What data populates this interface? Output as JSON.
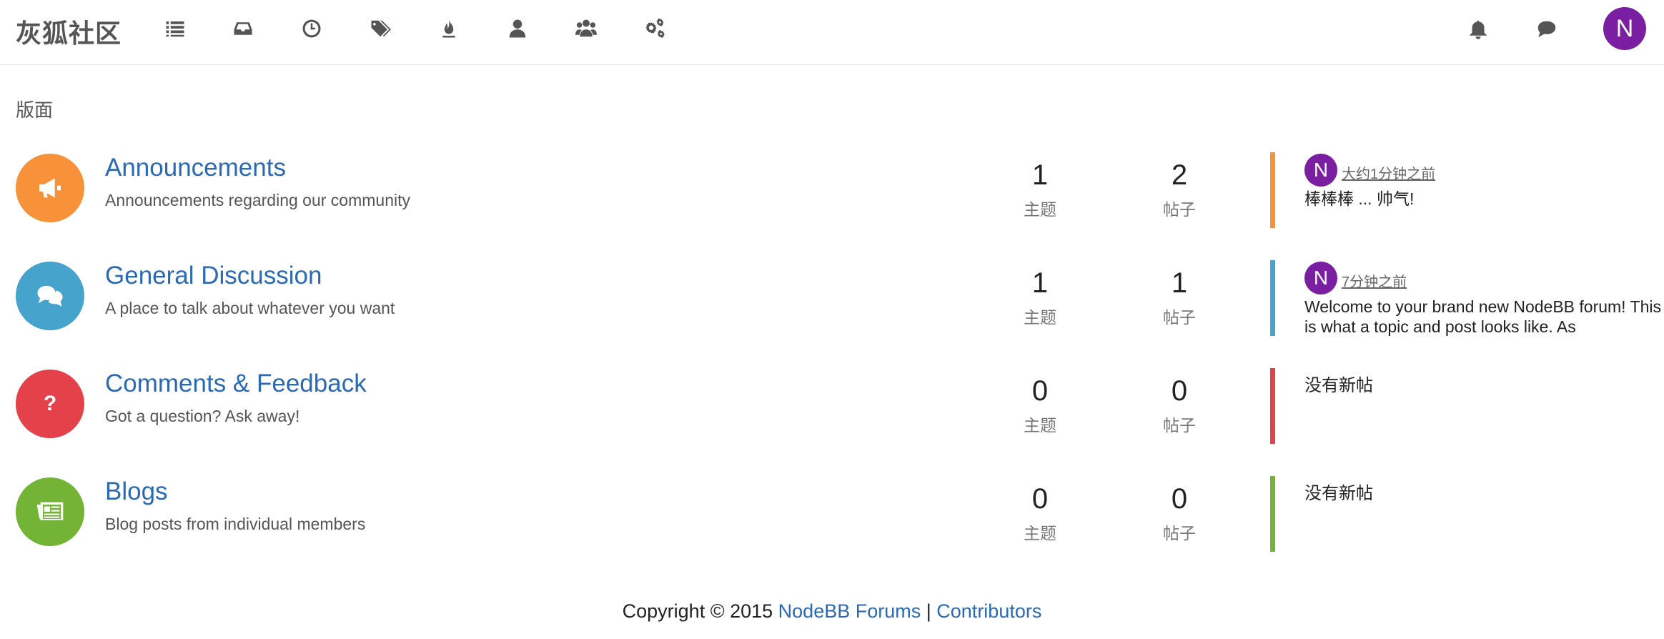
{
  "header": {
    "brand": "灰狐社区",
    "nav": [
      {
        "name": "categories-icon",
        "icon": "list"
      },
      {
        "name": "unread-icon",
        "icon": "inbox"
      },
      {
        "name": "recent-icon",
        "icon": "clock"
      },
      {
        "name": "tags-icon",
        "icon": "tags"
      },
      {
        "name": "popular-icon",
        "icon": "fire"
      },
      {
        "name": "users-icon",
        "icon": "user"
      },
      {
        "name": "groups-icon",
        "icon": "group"
      },
      {
        "name": "admin-icon",
        "icon": "cogs"
      }
    ],
    "notifications_icon": "bell",
    "chats_icon": "comment",
    "user_avatar_letter": "N",
    "avatar_color": "#7b1fa2"
  },
  "section_title": "版面",
  "categories": [
    {
      "title": "Announcements",
      "description": "Announcements regarding our community",
      "icon": "bullhorn",
      "color": "#f7923a",
      "topics": "1",
      "posts": "2",
      "topics_label": "主题",
      "posts_label": "帖子",
      "teaser": {
        "avatar": "N",
        "time": "大约1分钟之前",
        "text": "棒棒棒 ... 帅气!"
      }
    },
    {
      "title": "General Discussion",
      "description": "A place to talk about whatever you want",
      "icon": "comments",
      "color": "#46a4cc",
      "topics": "1",
      "posts": "1",
      "topics_label": "主题",
      "posts_label": "帖子",
      "teaser": {
        "avatar": "N",
        "time": "7分钟之前",
        "text": "Welcome to your brand new NodeBB forum! This is what a topic and post looks like. As"
      }
    },
    {
      "title": "Comments & Feedback",
      "description": "Got a question? Ask away!",
      "icon": "question",
      "color": "#e5414b",
      "topics": "0",
      "posts": "0",
      "topics_label": "主题",
      "posts_label": "帖子",
      "no_posts": "没有新帖"
    },
    {
      "title": "Blogs",
      "description": "Blog posts from individual members",
      "icon": "newspaper",
      "color": "#73b335",
      "topics": "0",
      "posts": "0",
      "topics_label": "主题",
      "posts_label": "帖子",
      "no_posts": "没有新帖"
    }
  ],
  "footer": {
    "copyright": "Copyright © 2015 ",
    "link1": "NodeBB Forums",
    "separator": " | ",
    "link2": "Contributors"
  }
}
